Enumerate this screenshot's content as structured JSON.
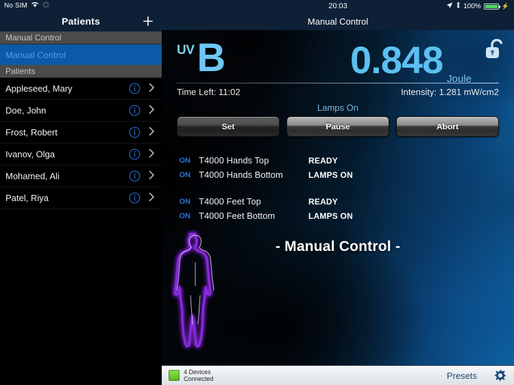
{
  "sidebar": {
    "status_bar": {
      "carrier": "No SIM",
      "wifi_icon": "wifi-icon",
      "activity_icon": "activity-spinner-icon"
    },
    "nav": {
      "title": "Patients",
      "add_label": "+",
      "add_icon": "plus-icon"
    },
    "sections": [
      {
        "header": "Manual Control",
        "items": [
          {
            "label": "Manual Control",
            "selected": true
          }
        ]
      },
      {
        "header": "Patients",
        "items": [
          {
            "label": "Appleseed, Mary"
          },
          {
            "label": "Doe, John"
          },
          {
            "label": "Frost, Robert"
          },
          {
            "label": "Ivanov, Olga"
          },
          {
            "label": "Mohamed, Ali"
          },
          {
            "label": "Patel, Riya"
          }
        ]
      }
    ],
    "row_icons": {
      "info": "info-circle-icon",
      "disclosure": "chevron-right-icon"
    }
  },
  "main": {
    "status_bar": {
      "time": "20:03",
      "location_icon": "location-arrow-icon",
      "bluetooth_icon": "bluetooth-icon",
      "battery_percent": "100%",
      "battery_icon": "battery-charging-icon"
    },
    "nav": {
      "title": "Manual Control"
    },
    "dose": {
      "uv_prefix": "UV",
      "uv_band": "B",
      "value": "0.848",
      "unit": "Joule",
      "lock_icon": "unlocked-padlock-icon",
      "time_left": "Time Left: 11:02",
      "intensity": "Intensity: 1.281 mW/cm2"
    },
    "lamps_status": "Lamps On",
    "buttons": [
      {
        "label": "Set",
        "style": "dim"
      },
      {
        "label": "Pause",
        "style": "bright"
      },
      {
        "label": "Abort",
        "style": "bright"
      }
    ],
    "devices": [
      {
        "on": "ON",
        "name": "T4000 Hands Top",
        "status": "READY"
      },
      {
        "on": "ON",
        "name": "T4000 Hands Bottom",
        "status": "LAMPS ON"
      },
      {
        "on": "ON",
        "name": "T4000 Feet Top",
        "status": "READY"
      },
      {
        "on": "ON",
        "name": "T4000 Feet Bottom",
        "status": "LAMPS ON"
      }
    ],
    "mode_title": "- Manual Control -",
    "body_figure_icon": "body-silhouette-icon",
    "toolbar": {
      "connection_line1": "4 Devices",
      "connection_line2": "Connected",
      "connection_indicator_icon": "green-status-square-icon",
      "presets_label": "Presets",
      "settings_icon": "gear-icon"
    }
  },
  "colors": {
    "accent_blue": "#5bc0f0",
    "nav_bg": "#0d2036",
    "selected_row": "#0b59a8",
    "status_green": "#59b61e",
    "body_outline": "#8a2be2"
  }
}
